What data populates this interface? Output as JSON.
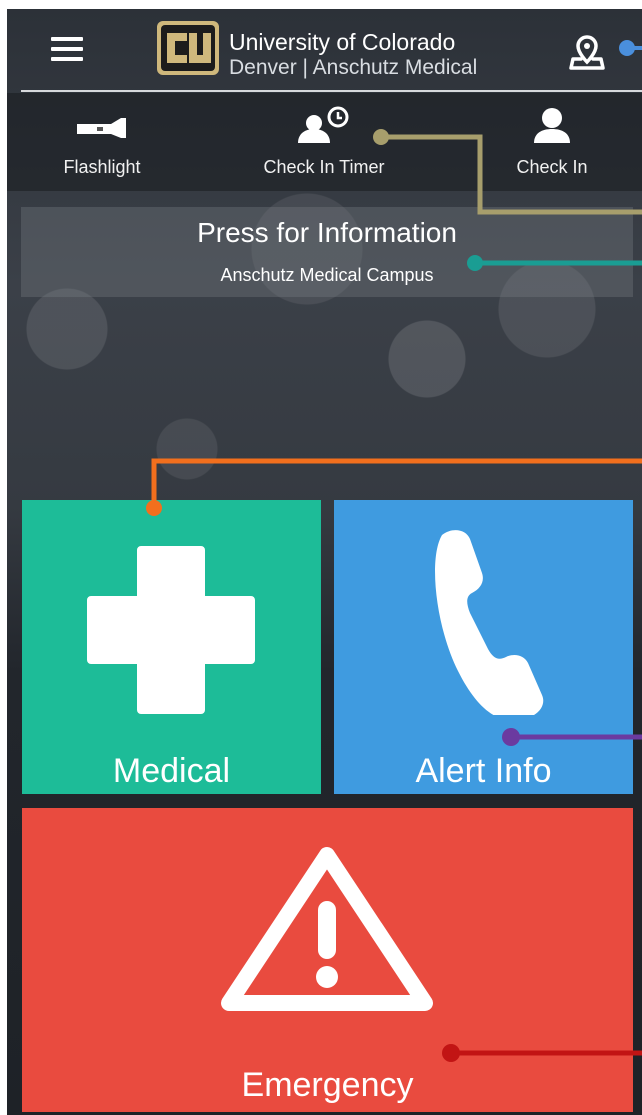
{
  "header": {
    "brand_line1": "University of Colorado",
    "brand_line2": "Denver | Anschutz Medical",
    "menu_icon": "hamburger-icon",
    "location_icon": "map-pin-icon",
    "logo_letters": "CU"
  },
  "toolbar": {
    "items": [
      {
        "label": "Flashlight",
        "icon": "flashlight-icon"
      },
      {
        "label": "Check In Timer",
        "icon": "user-clock-icon"
      },
      {
        "label": "Check In",
        "icon": "user-icon"
      }
    ]
  },
  "info": {
    "title": "Press for Information",
    "subtitle": "Anschutz Medical Campus"
  },
  "tiles": {
    "medical": {
      "label": "Medical",
      "icon": "medical-cross-icon",
      "color": "#1dbc98"
    },
    "alert": {
      "label": "Alert Info",
      "icon": "phone-icon",
      "color": "#3f9be0"
    },
    "emergency": {
      "label": "Emergency",
      "icon": "warning-icon",
      "color": "#e94b3f"
    }
  },
  "callout_colors": {
    "location": "#4a8fdc",
    "timer": "#a79e6c",
    "info": "#1a9d93",
    "medical": "#f26f1d",
    "alert": "#6b3aa0",
    "emergency": "#c21414"
  }
}
